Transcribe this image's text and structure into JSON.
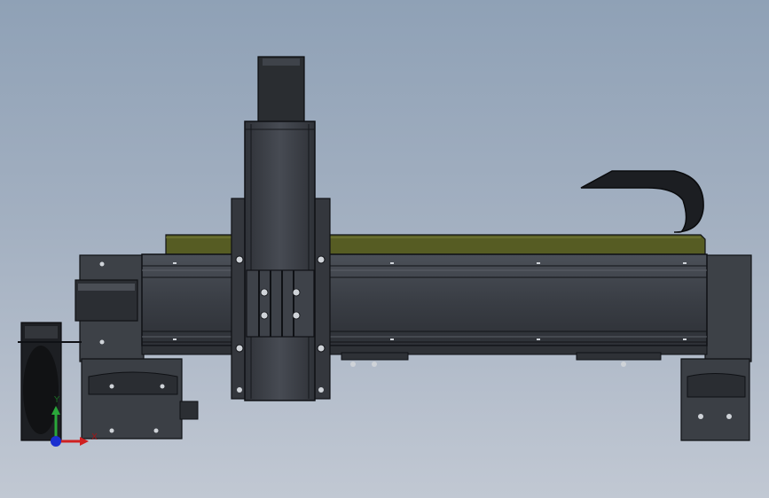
{
  "viewport": {
    "background_top": "#8fa1b6",
    "background_bottom": "#c1c8d3",
    "model": {
      "body_color": "#3a3e45",
      "edge_color": "#0f1115",
      "cover_color": "#565c23"
    }
  },
  "triad": {
    "y_label": "Y",
    "x_label": "X",
    "y_color": "#2aa83a",
    "x_color": "#d02020",
    "z_color": "#1a2fd0"
  }
}
